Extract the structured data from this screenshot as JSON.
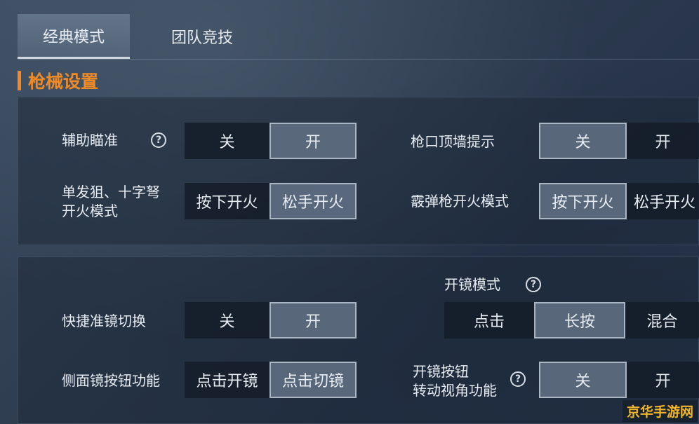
{
  "tabs": [
    {
      "label": "经典模式"
    },
    {
      "label": "团队竞技"
    }
  ],
  "section_title": "枪械设置",
  "panel1": {
    "aim_assist": {
      "label": "辅助瞄准",
      "options": [
        "关",
        "开"
      ],
      "selected": "开"
    },
    "muzzle_wall": {
      "label": "枪口顶墙提示",
      "options": [
        "关",
        "开"
      ],
      "selected": "关"
    },
    "sniper_fire": {
      "label_line1": "单发狙、十字弩",
      "label_line2": "开火模式",
      "options": [
        "按下开火",
        "松手开火"
      ],
      "selected": "松手开火"
    },
    "shotgun_fire": {
      "label": "霰弹枪开火模式",
      "options": [
        "按下开火",
        "松手开火"
      ],
      "selected": "按下开火"
    }
  },
  "panel2": {
    "quick_scope": {
      "label": "快捷准镜切换",
      "options": [
        "关",
        "开"
      ],
      "selected": "开"
    },
    "scope_mode": {
      "label": "开镜模式",
      "options": [
        "点击",
        "长按",
        "混合"
      ],
      "selected": "长按"
    },
    "side_scope": {
      "label": "侧面镜按钮功能",
      "options": [
        "点击开镜",
        "点击切镜"
      ],
      "selected": "点击切镜"
    },
    "scope_rotate": {
      "label_line1": "开镜按钮",
      "label_line2": "转动视角功能",
      "options": [
        "关",
        "开"
      ],
      "selected": "关"
    }
  },
  "help_icon_char": "?",
  "watermark": "京华手游网"
}
